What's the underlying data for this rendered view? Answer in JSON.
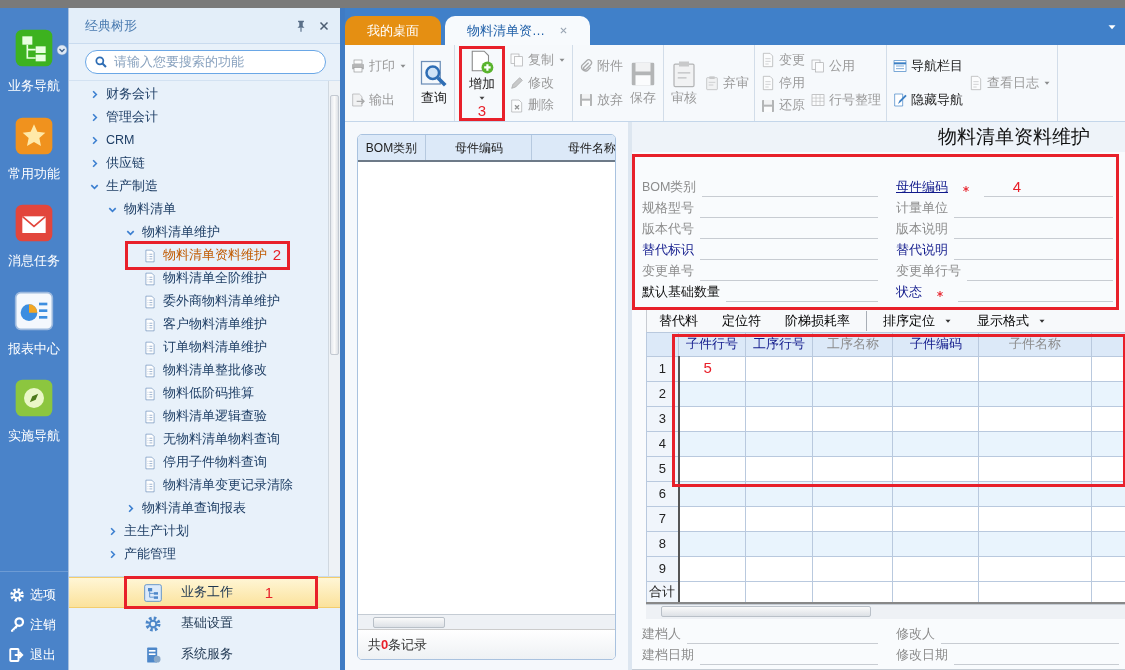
{
  "rail": {
    "items": [
      {
        "label": "业务导航",
        "kind": "tree",
        "menu": true
      },
      {
        "label": "常用功能",
        "kind": "star",
        "menu": false
      },
      {
        "label": "消息任务",
        "kind": "mail",
        "menu": false
      },
      {
        "label": "报表中心",
        "kind": "report",
        "menu": false
      },
      {
        "label": "实施导航",
        "kind": "compass",
        "menu": false
      }
    ],
    "footer": [
      {
        "label": "选项",
        "kind": "gear"
      },
      {
        "label": "注销",
        "kind": "key"
      },
      {
        "label": "退出",
        "kind": "exit"
      }
    ]
  },
  "tree_panel": {
    "title": "经典树形",
    "search": {
      "placeholder": "请输入您要搜索的功能"
    },
    "items": [
      {
        "label": "财务会计",
        "kind": "folder",
        "expanded": false
      },
      {
        "label": "管理会计",
        "kind": "folder",
        "expanded": false
      },
      {
        "label": "CRM",
        "kind": "folder",
        "expanded": false
      },
      {
        "label": "供应链",
        "kind": "folder",
        "expanded": false
      },
      {
        "label": "生产制造",
        "kind": "folder",
        "expanded": true,
        "children": [
          {
            "label": "物料清单",
            "kind": "folder",
            "expanded": true,
            "children": [
              {
                "label": "物料清单维护",
                "kind": "folder",
                "expanded": true,
                "children": [
                  {
                    "label": "物料清单资料维护",
                    "kind": "page",
                    "selected": true,
                    "callout": "2"
                  },
                  {
                    "label": "物料清单全阶维护",
                    "kind": "page",
                    "selected": false
                  },
                  {
                    "label": "委外商物料清单维护",
                    "kind": "page",
                    "selected": false
                  },
                  {
                    "label": "客户物料清单维护",
                    "kind": "page",
                    "selected": false
                  },
                  {
                    "label": "订单物料清单维护",
                    "kind": "page",
                    "selected": false
                  },
                  {
                    "label": "物料清单整批修改",
                    "kind": "page",
                    "selected": false
                  },
                  {
                    "label": "物料低阶码推算",
                    "kind": "page",
                    "selected": false
                  },
                  {
                    "label": "物料清单逻辑查验",
                    "kind": "page",
                    "selected": false
                  },
                  {
                    "label": "无物料清单物料查询",
                    "kind": "page",
                    "selected": false
                  },
                  {
                    "label": "停用子件物料查询",
                    "kind": "page",
                    "selected": false
                  },
                  {
                    "label": "物料清单变更记录清除",
                    "kind": "page",
                    "selected": false
                  }
                ]
              },
              {
                "label": "物料清单查询报表",
                "kind": "folder",
                "expanded": false
              }
            ]
          },
          {
            "label": "主生产计划",
            "kind": "folder",
            "expanded": false
          },
          {
            "label": "产能管理",
            "kind": "folder",
            "expanded": false
          }
        ]
      }
    ],
    "sections": [
      {
        "label": "业务工作",
        "kind": "tree",
        "selected": true,
        "callout": "1"
      },
      {
        "label": "基础设置",
        "kind": "gear",
        "selected": false
      },
      {
        "label": "系统服务",
        "kind": "server",
        "selected": false
      }
    ]
  },
  "tabs": [
    {
      "label": "我的桌面",
      "selected": false,
      "closable": false
    },
    {
      "label": "物料清单资…",
      "selected": true,
      "closable": true
    }
  ],
  "toolbar": {
    "groups": [
      {
        "columns": [
          [
            {
              "label": "打印",
              "kind": "printer",
              "disabled": true,
              "caret": true
            },
            {
              "label": "输出",
              "kind": "export",
              "disabled": true,
              "caret": false
            }
          ]
        ]
      },
      {
        "columns": [
          [
            {
              "label": "查询",
              "kind": "search",
              "disabled": false,
              "caret": false
            }
          ]
        ]
      },
      {
        "columns": [
          [
            {
              "label": "增加",
              "kind": "add",
              "disabled": false,
              "caret": true,
              "callout": "3"
            }
          ],
          [
            {
              "label": "复制",
              "kind": "copy",
              "disabled": true,
              "caret": true
            },
            {
              "label": "修改",
              "kind": "edit",
              "disabled": true,
              "caret": false
            },
            {
              "label": "删除",
              "kind": "delete",
              "disabled": true,
              "caret": false
            }
          ]
        ]
      },
      {
        "columns": [
          [
            {
              "label": "附件",
              "kind": "attach",
              "disabled": true,
              "caret": false
            },
            {
              "label": "放弃",
              "kind": "discard",
              "disabled": true,
              "caret": false
            }
          ],
          [
            {
              "label": "保存",
              "kind": "save",
              "disabled": true,
              "caret": false
            }
          ]
        ]
      },
      {
        "columns": [
          [
            {
              "label": "审核",
              "kind": "audit",
              "disabled": true,
              "caret": false
            }
          ],
          [
            {
              "label": "弃审",
              "kind": "unaudit",
              "disabled": true,
              "caret": false
            }
          ]
        ]
      },
      {
        "columns": [
          [
            {
              "label": "变更",
              "kind": "change",
              "disabled": true,
              "caret": false
            },
            {
              "label": "停用",
              "kind": "stop",
              "disabled": true,
              "caret": false
            },
            {
              "label": "还原",
              "kind": "restore",
              "disabled": true,
              "caret": false
            }
          ],
          [
            {
              "label": "公用",
              "kind": "share",
              "disabled": true,
              "caret": false
            },
            {
              "label": "行号整理",
              "kind": "renumber",
              "disabled": true,
              "caret": false
            }
          ]
        ]
      },
      {
        "columns": [
          [
            {
              "label": "导航栏目",
              "kind": "nav",
              "disabled": false,
              "caret": false
            },
            {
              "label": "隐藏导航",
              "kind": "note",
              "disabled": false,
              "caret": false
            }
          ],
          [
            {
              "label": "查看日志",
              "kind": "log",
              "disabled": true,
              "caret": true
            }
          ]
        ]
      }
    ]
  },
  "list_panel": {
    "columns": [
      "BOM类别",
      "母件编码",
      "母件名称"
    ],
    "footer": "共**0**条记录"
  },
  "form": {
    "title": "物料清单资料维护",
    "callout": "4",
    "fields": [
      {
        "label": "BOM类别",
        "kind": "muted",
        "required": false
      },
      {
        "label": "母件编码",
        "kind": "link",
        "required": true
      },
      {
        "label": "规格型号",
        "kind": "muted",
        "required": false
      },
      {
        "label": "计量单位",
        "kind": "muted",
        "required": false
      },
      {
        "label": "版本代号",
        "kind": "muted",
        "required": false
      },
      {
        "label": "版本说明",
        "kind": "muted",
        "required": false
      },
      {
        "label": "替代标识",
        "kind": "emphasis",
        "required": false
      },
      {
        "label": "替代说明",
        "kind": "emphasis",
        "required": false
      },
      {
        "label": "变更单号",
        "kind": "muted",
        "required": false
      },
      {
        "label": "变更单行号",
        "kind": "muted",
        "required": false
      },
      {
        "label": "默认基础数量",
        "kind": "default",
        "required": false
      },
      {
        "label": "状态",
        "kind": "emphasis",
        "required": true
      }
    ]
  },
  "grid_toolbar": [
    {
      "label": "替代料",
      "divider": false,
      "caret": false
    },
    {
      "label": "定位符",
      "divider": false,
      "caret": false
    },
    {
      "label": "阶梯损耗率",
      "divider": false,
      "caret": false
    },
    {
      "label": "排序定位",
      "divider": true,
      "caret": true
    },
    {
      "label": "显示格式",
      "divider": false,
      "caret": true
    }
  ],
  "grid": {
    "callout": "5",
    "columns": [
      {
        "label": "子件行号",
        "kind": "emphasis"
      },
      {
        "label": "工序行号",
        "kind": "emphasis"
      },
      {
        "label": "工序名称",
        "kind": "muted"
      },
      {
        "label": "子件编码",
        "kind": "emphasis"
      },
      {
        "label": "子件名称",
        "kind": "muted"
      }
    ],
    "rows": [
      "1",
      "2",
      "3",
      "4",
      "5",
      "6",
      "7",
      "8",
      "9"
    ],
    "total_label": "合计"
  },
  "audit_fields": [
    "建档人",
    "修改人",
    "建档日期",
    "修改日期"
  ]
}
